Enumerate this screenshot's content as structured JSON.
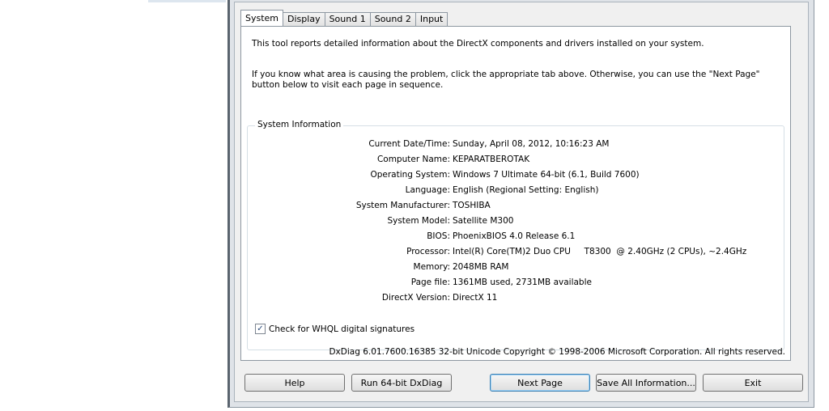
{
  "tabs": [
    {
      "label": "System",
      "active": true
    },
    {
      "label": "Display",
      "active": false
    },
    {
      "label": "Sound 1",
      "active": false
    },
    {
      "label": "Sound 2",
      "active": false
    },
    {
      "label": "Input",
      "active": false
    }
  ],
  "intro": {
    "line1": "This tool reports detailed information about the DirectX components and drivers installed on your system.",
    "line2": "If you know what area is causing the problem, click the appropriate tab above.  Otherwise, you can use the \"Next Page\" button below to visit each page in sequence."
  },
  "system_info": {
    "title": "System Information",
    "rows": [
      {
        "label": "Current Date/Time:",
        "value": "Sunday, April 08, 2012, 10:16:23 AM"
      },
      {
        "label": "Computer Name:",
        "value": "KEPARATBEROTAK"
      },
      {
        "label": "Operating System:",
        "value": "Windows 7 Ultimate 64-bit (6.1, Build 7600)"
      },
      {
        "label": "Language:",
        "value": "English (Regional Setting: English)"
      },
      {
        "label": "System Manufacturer:",
        "value": "TOSHIBA"
      },
      {
        "label": "System Model:",
        "value": "Satellite M300"
      },
      {
        "label": "BIOS:",
        "value": "PhoenixBIOS 4.0 Release 6.1"
      },
      {
        "label": "Processor:",
        "value": "Intel(R) Core(TM)2 Duo CPU     T8300  @ 2.40GHz (2 CPUs), ~2.4GHz"
      },
      {
        "label": "Memory:",
        "value": "2048MB RAM"
      },
      {
        "label": "Page file:",
        "value": "1361MB used, 2731MB available"
      },
      {
        "label": "DirectX Version:",
        "value": "DirectX 11"
      }
    ]
  },
  "whql_check": {
    "label": "Check for WHQL digital signatures",
    "checked": true,
    "mark": "✓"
  },
  "copyright": "DxDiag 6.01.7600.16385 32-bit Unicode  Copyright © 1998-2006 Microsoft Corporation.  All rights reserved.",
  "buttons": {
    "help": "Help",
    "run64": "Run 64-bit DxDiag",
    "next": "Next Page",
    "save": "Save All Information...",
    "exit": "Exit"
  }
}
